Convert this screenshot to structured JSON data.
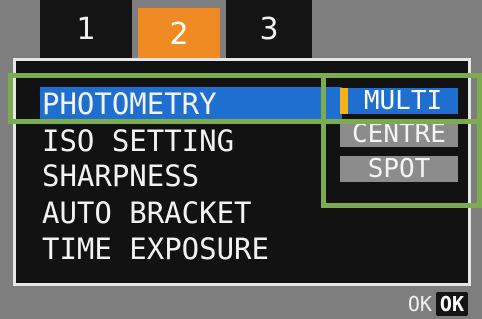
{
  "tabs": [
    "1",
    "2",
    "3"
  ],
  "active_tab": "2",
  "menu": {
    "items": [
      "PHOTOMETRY",
      "ISO SETTING",
      "SHARPNESS",
      "AUTO BRACKET",
      "TIME EXPOSURE"
    ],
    "selected": "PHOTOMETRY"
  },
  "options": {
    "items": [
      "MULTI",
      "CENTRE",
      "SPOT"
    ],
    "selected": "MULTI"
  },
  "footer": {
    "ok_label": "OK",
    "ok_key": "OK"
  },
  "colors": {
    "highlight": "#1f6fd0",
    "active_tab": "#f08a22",
    "callout": "#7cab52"
  }
}
